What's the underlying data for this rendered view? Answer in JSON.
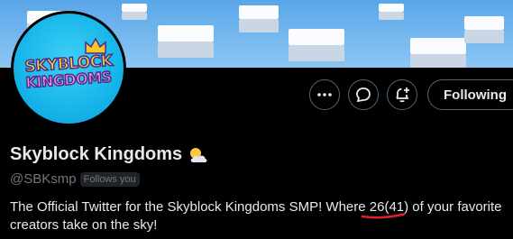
{
  "banner": {
    "description_icon": "cloud-cubes"
  },
  "avatar": {
    "logo_line1": "SKYBLOCK",
    "logo_line2": "KINGDOMS",
    "crown_icon": "crown-icon"
  },
  "actions": {
    "more_icon": "more-icon",
    "message_icon": "message-icon",
    "notify_icon": "notification-plus-icon",
    "follow_label": "Following"
  },
  "profile": {
    "display_name": "Skyblock Kingdoms",
    "name_emoji_icon": "sun-behind-cloud-icon",
    "handle": "@SBKsmp",
    "follows_you": "Follows you",
    "bio_part1": "The Official Twitter for the Skyblock Kingdoms SMP! Where ",
    "bio_highlight": "26(41)",
    "bio_part2": " of your favorite creators take on the sky!"
  },
  "colors": {
    "background": "#000000",
    "text": "#e7e9ea",
    "muted": "#71767b",
    "annotation": "#e0202a"
  }
}
